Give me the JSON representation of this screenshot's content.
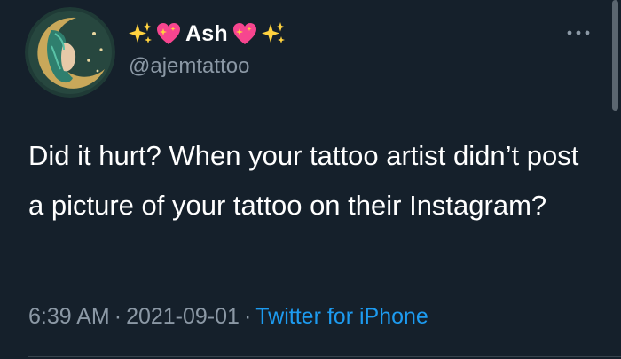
{
  "author": {
    "name": "Ash",
    "handle": "@ajemtattoo",
    "name_prefix_emojis": [
      "sparkles-icon",
      "sparkling-heart-icon"
    ],
    "name_suffix_emojis": [
      "sparkling-heart-icon",
      "sparkles-icon"
    ]
  },
  "tweet": {
    "text": "Did it hurt? When your tattoo artist didn’t post a picture of your tattoo on their Instagram?",
    "time": "6:39 AM",
    "date": "2021-09-01",
    "separator": "·",
    "source": "Twitter for iPhone"
  },
  "colors": {
    "background": "#15202b",
    "text": "#ffffff",
    "secondary_text": "#8b98a5",
    "link": "#1d9bf0",
    "divider": "#38444d"
  }
}
